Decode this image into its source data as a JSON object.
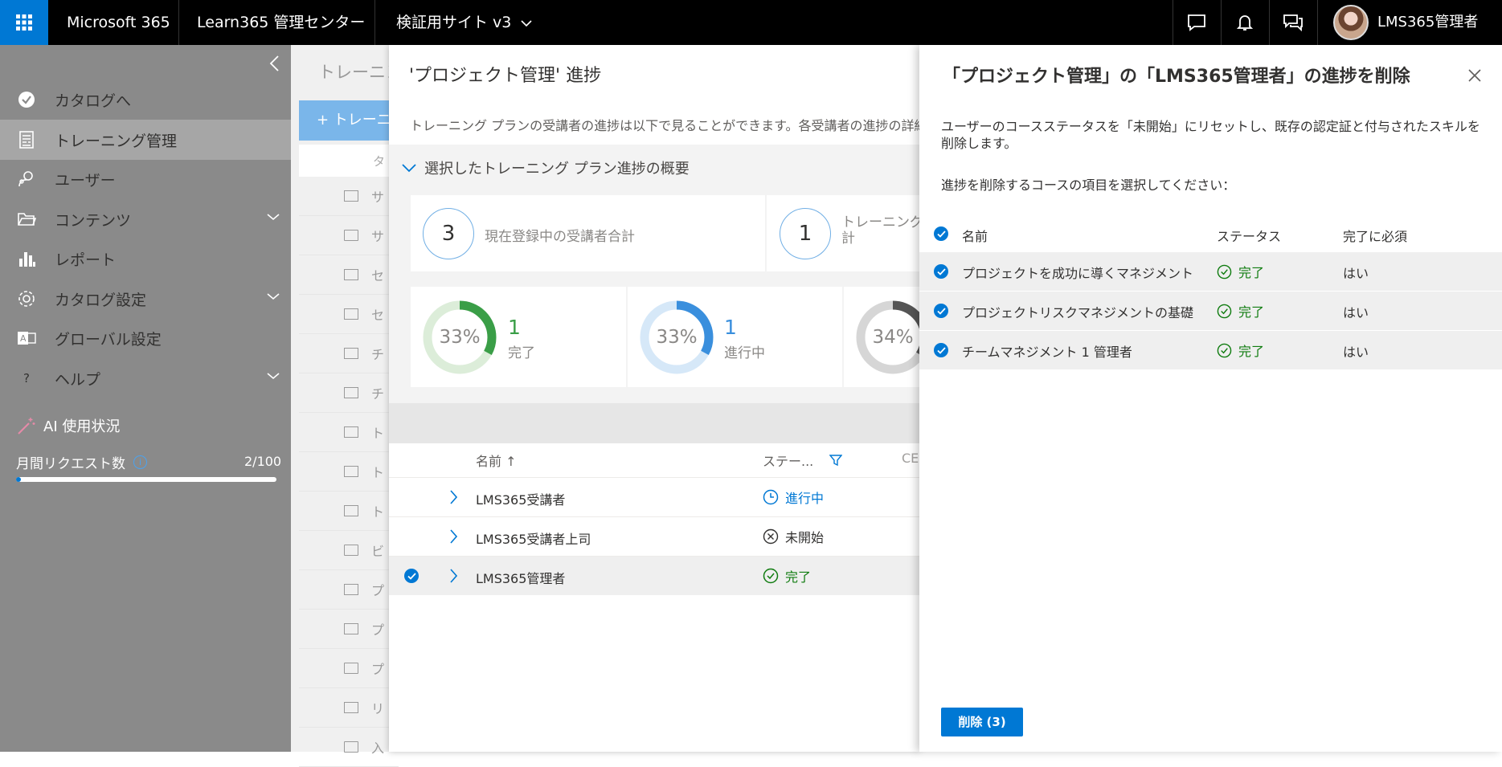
{
  "topbar": {
    "brand": "Microsoft 365",
    "app": "Learn365 管理センター",
    "site": "検証用サイト v3",
    "user": "LMS365管理者"
  },
  "sidebar": {
    "items": [
      {
        "label": "カタログへ",
        "icon": "check-circle-icon"
      },
      {
        "label": "トレーニング管理",
        "icon": "training-management-icon"
      },
      {
        "label": "ユーザー",
        "icon": "users-icon"
      },
      {
        "label": "コンテンツ",
        "icon": "folder-icon"
      },
      {
        "label": "レポート",
        "icon": "bar-chart-icon"
      },
      {
        "label": "カタログ設定",
        "icon": "gear-icon"
      },
      {
        "label": "グローバル設定",
        "icon": "translate-icon"
      },
      {
        "label": "ヘルプ",
        "icon": "help-icon"
      }
    ],
    "ai_usage": "AI 使用状況",
    "monthly_requests_label": "月間リクエスト数",
    "monthly_requests_value": "2/100",
    "monthly_requests_fraction": 0.02
  },
  "background": {
    "title": "トレーニン",
    "button": "+ トレーニ",
    "col_prefix": "タ",
    "rows": [
      "サ",
      "サ",
      "セ",
      "セ",
      "チ",
      "チ",
      "ト",
      "ト",
      "ト",
      "ビ",
      "プ",
      "プ",
      "プ",
      "リ",
      "入"
    ]
  },
  "middle": {
    "title": "'プロジェクト管理' 進捗",
    "description": "トレーニング プランの受講者の進捗は以下で見ることができます。各受講者の進捗の詳細",
    "summary_toggle": "選択したトレーニング プラン進捗の概要",
    "stats": [
      {
        "value": "3",
        "label": "現在登録中の受講者合計"
      },
      {
        "value": "1",
        "label": "トレーニング\n計"
      }
    ],
    "donuts": [
      {
        "percent_label": "33%",
        "count": "1",
        "label": "完了",
        "fraction": 0.33,
        "color": "#3a9e47",
        "track": "#dcedd9"
      },
      {
        "percent_label": "33%",
        "count": "1",
        "label": "進行中",
        "fraction": 0.33,
        "color": "#3a8fdd",
        "track": "#d6e8f8"
      },
      {
        "percent_label": "34%",
        "fraction": 0.34,
        "color": "#555555",
        "track": "#d6d6d6"
      }
    ],
    "table": {
      "col_name": "名前 ↑",
      "col_status": "ステー...",
      "col_ceu": "CEU",
      "rows": [
        {
          "name": "LMS365受講者",
          "status": "進行中",
          "status_icon": "clock-icon"
        },
        {
          "name": "LMS365受講者上司",
          "status": "未開始",
          "status_icon": "x-circle-icon"
        },
        {
          "name": "LMS365管理者",
          "status": "完了",
          "status_icon": "check-circle-icon",
          "selected": true
        }
      ]
    }
  },
  "right": {
    "title": "「プロジェクト管理」の「LMS365管理者」の進捗を削除",
    "desc1": "ユーザーのコースステータスを「未開始」にリセットし、既存の認定証と付与されたスキルを",
    "desc2": "削除します。",
    "instruction": "進捗を削除するコースの項目を選択してください：",
    "col_name": "名前",
    "col_status": "ステータス",
    "col_required": "完了に必須",
    "rows": [
      {
        "name": "プロジェクトを成功に導くマネジメント",
        "status": "完了",
        "required": "はい"
      },
      {
        "name": "プロジェクトリスクマネジメントの基礎",
        "status": "完了",
        "required": "はい"
      },
      {
        "name": "チームマネジメント 1 管理者",
        "status": "完了",
        "required": "はい"
      }
    ],
    "delete_button": "削除 (3)"
  }
}
